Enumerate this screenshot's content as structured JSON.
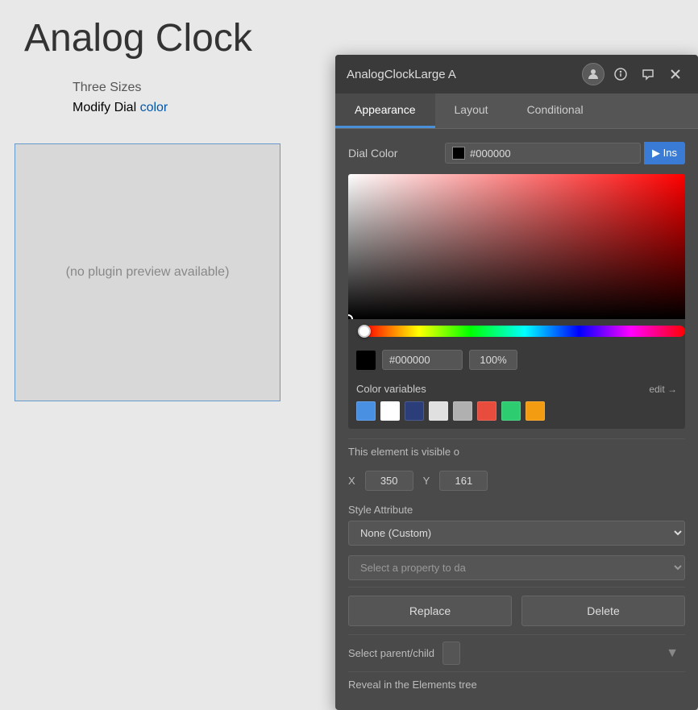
{
  "page": {
    "title": "Analog Clock",
    "subtitle1": "Three Sizes",
    "subtitle2_prefix": "Modify Dial ",
    "subtitle2_highlight": "color",
    "preview_text": "(no plugin preview available)"
  },
  "panel": {
    "title": "AnalogClockLarge A",
    "tabs": [
      {
        "label": "Appearance",
        "active": true
      },
      {
        "label": "Layout",
        "active": false
      },
      {
        "label": "Conditional",
        "active": false
      }
    ],
    "dial_color_label": "Dial Color",
    "dial_color_value": "#000000",
    "ins_label": "▶ Ins",
    "hex_value": "#000000",
    "opacity_value": "100%",
    "color_vars_label": "Color variables",
    "color_vars_edit": "edit →",
    "swatches": [
      {
        "color": "#4a90e2",
        "name": "blue"
      },
      {
        "color": "#ffffff",
        "name": "white"
      },
      {
        "color": "#2c3e7a",
        "name": "dark-blue"
      },
      {
        "color": "#e0e0e0",
        "name": "light-gray"
      },
      {
        "color": "#b0b0b0",
        "name": "gray"
      },
      {
        "color": "#e74c3c",
        "name": "red"
      },
      {
        "color": "#2ecc71",
        "name": "green"
      },
      {
        "color": "#f39c12",
        "name": "orange"
      }
    ],
    "visibility_text": "This element is visible o",
    "x_label": "X",
    "x_value": "350",
    "y_label": "Y",
    "y_value": "161",
    "style_attr_label": "Style Attribute",
    "style_attr_value": "None (Custom)",
    "property_placeholder": "Select a property to da",
    "replace_label": "Replace",
    "delete_label": "Delete",
    "parent_child_label": "Select parent/child",
    "reveal_label": "Reveal in the Elements tree"
  }
}
